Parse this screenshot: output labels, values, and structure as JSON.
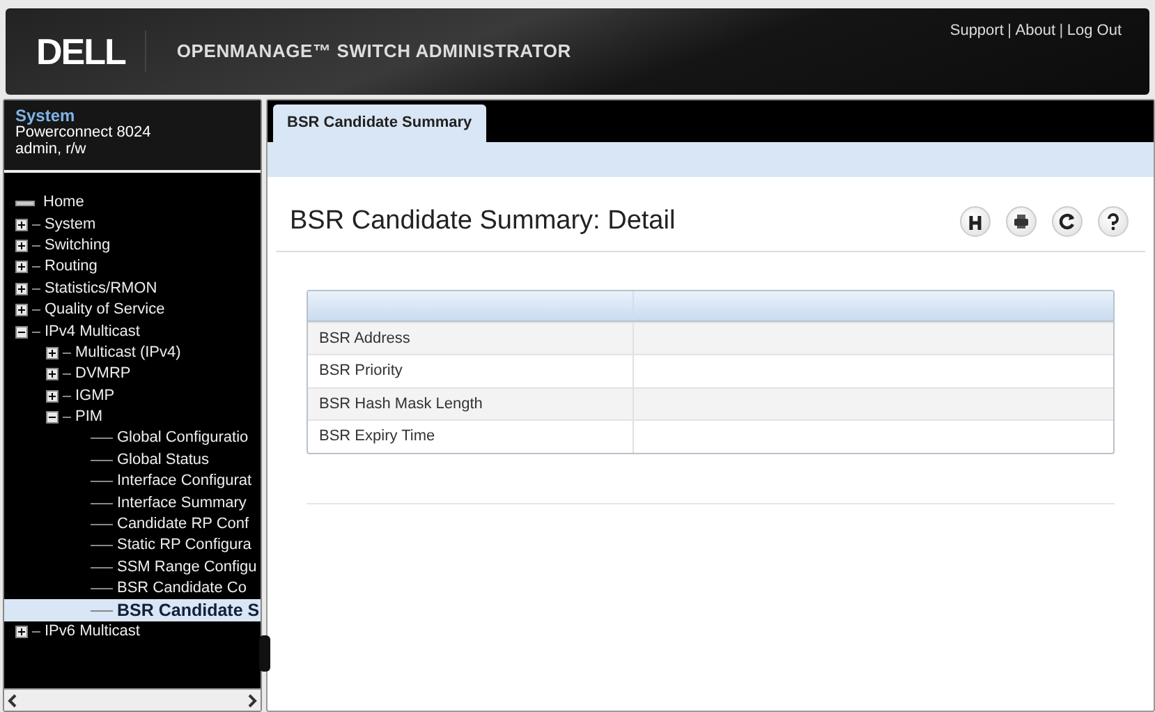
{
  "header": {
    "brand": "DELL",
    "product": "OPENMANAGE™ SWITCH ADMINISTRATOR",
    "links": [
      "Support",
      "About",
      "Log Out"
    ],
    "separators": [
      "|",
      "|"
    ]
  },
  "system": {
    "title": "System",
    "model": "Powerconnect 8024",
    "user": "admin, r/w"
  },
  "tree": [
    {
      "label": "Home",
      "kind": "home",
      "selected": false
    },
    {
      "label": "System",
      "kind": "folder",
      "expanded": false,
      "selected": false
    },
    {
      "label": "Switching",
      "kind": "folder",
      "expanded": false,
      "selected": false
    },
    {
      "label": "Routing",
      "kind": "folder",
      "expanded": false,
      "selected": false
    },
    {
      "label": "Statistics/RMON",
      "kind": "folder",
      "expanded": false,
      "selected": false
    },
    {
      "label": "Quality of Service",
      "kind": "folder",
      "expanded": false,
      "selected": false
    },
    {
      "label": "IPv4 Multicast",
      "kind": "folder",
      "expanded": true,
      "selected": false,
      "children": [
        {
          "label": "Multicast (IPv4)",
          "kind": "folder",
          "expanded": false,
          "selected": false
        },
        {
          "label": "DVMRP",
          "kind": "folder",
          "expanded": false,
          "selected": false
        },
        {
          "label": "IGMP",
          "kind": "folder",
          "expanded": false,
          "selected": false
        },
        {
          "label": "PIM",
          "kind": "folder",
          "expanded": true,
          "selected": false,
          "children": [
            {
              "label": "Global Configuratio",
              "kind": "leaf",
              "selected": false
            },
            {
              "label": "Global Status",
              "kind": "leaf",
              "selected": false
            },
            {
              "label": "Interface Configurat",
              "kind": "leaf",
              "selected": false
            },
            {
              "label": "Interface Summary",
              "kind": "leaf",
              "selected": false
            },
            {
              "label": "Candidate RP Conf",
              "kind": "leaf",
              "selected": false
            },
            {
              "label": "Static RP Configura",
              "kind": "leaf",
              "selected": false
            },
            {
              "label": "SSM Range Configu",
              "kind": "leaf",
              "selected": false
            },
            {
              "label": "BSR Candidate Co",
              "kind": "leaf",
              "selected": false
            },
            {
              "label": "BSR Candidate S",
              "kind": "leaf",
              "selected": true
            }
          ]
        }
      ]
    },
    {
      "label": "IPv6 Multicast",
      "kind": "folder",
      "expanded": false,
      "selected": false
    }
  ],
  "tabs": [
    {
      "label": "BSR Candidate Summary",
      "selected": true
    }
  ],
  "page_title": "BSR Candidate Summary: Detail",
  "toolbar": [
    {
      "kind": "save"
    },
    {
      "kind": "print"
    },
    {
      "kind": "refresh"
    },
    {
      "kind": "help"
    }
  ],
  "table": {
    "rows": [
      {
        "label": "BSR Address"
      },
      {
        "label": "BSR Priority"
      },
      {
        "label": "BSR Hash Mask Length"
      },
      {
        "label": "BSR Expiry Time"
      }
    ]
  }
}
